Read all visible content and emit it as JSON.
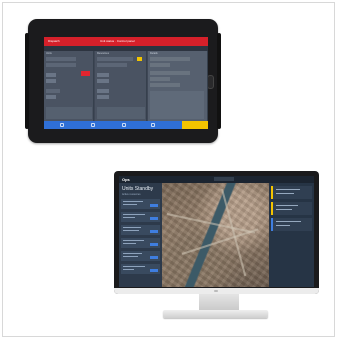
{
  "tablet": {
    "app_title": "Dispatch",
    "tab_label": "Unit status · Control panel",
    "columns": [
      {
        "label": "Units"
      },
      {
        "label": "Resources"
      },
      {
        "label": "Details"
      }
    ],
    "bottom_bar": {
      "accent_color": "#f4c400",
      "bar_color": "#2f6fd6"
    },
    "accent_color": "#d6202a"
  },
  "monitor": {
    "app_logo": "Ops",
    "left_panel": {
      "heading": "Units Standby",
      "subheading": "Active resources"
    },
    "map": {
      "view": "satellite"
    },
    "right_panel": {
      "title": "Incidents"
    },
    "brand_color": "#3f7ee0"
  }
}
